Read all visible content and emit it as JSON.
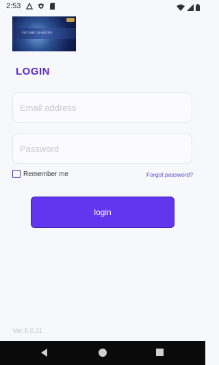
{
  "status_bar": {
    "time": "2:53",
    "icons": [
      "android-icon",
      "shield-icon",
      "sd-card-icon",
      "wifi-icon",
      "signal-icon",
      "battery-icon"
    ]
  },
  "banner": {
    "text": "FUTURE LEADERS"
  },
  "login": {
    "title": "LOGIN",
    "email_placeholder": "Email address",
    "email_value": "",
    "password_placeholder": "Password",
    "password_value": "",
    "remember_label": "Remember me",
    "remember_checked": false,
    "forgot_label": "Forgot password?",
    "button_label": "login"
  },
  "footer": {
    "version": "Ver.8.0.11"
  },
  "nav_bar": {
    "buttons": [
      "back",
      "home",
      "recents"
    ]
  },
  "colors": {
    "accent": "#6236ef",
    "title": "#5b2bd6",
    "background": "#f7f8fc"
  }
}
